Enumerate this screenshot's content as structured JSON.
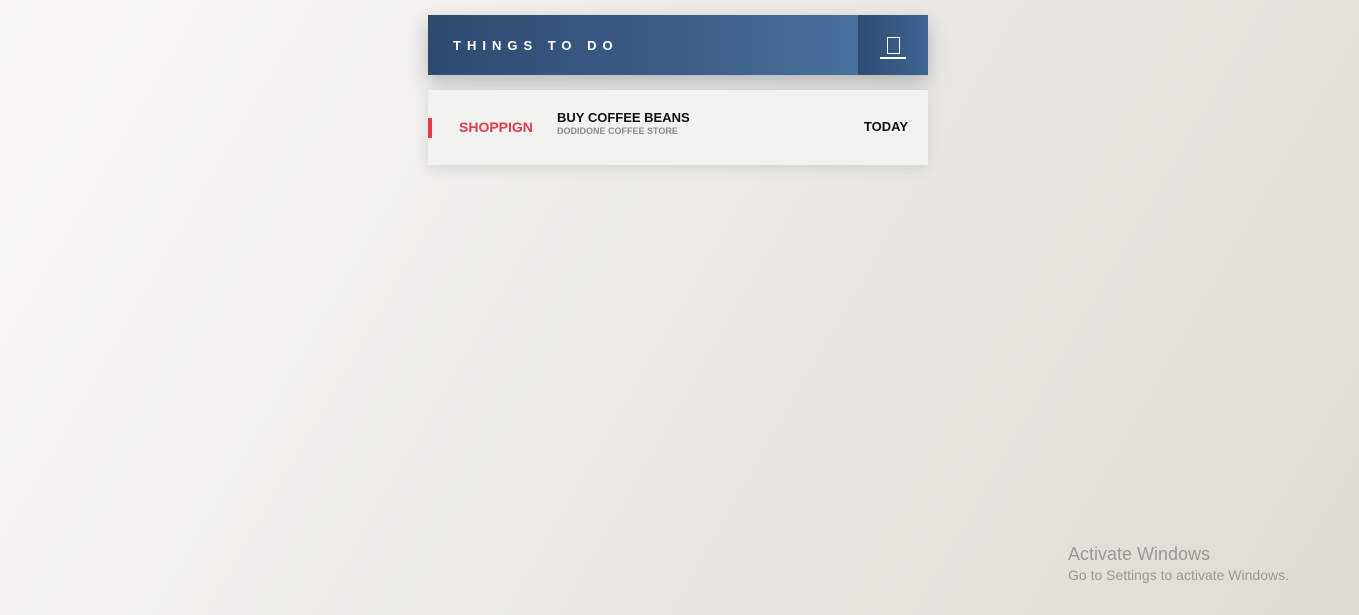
{
  "header": {
    "title": "THINGS TO DO",
    "action_icon": "notebook-icon"
  },
  "tasks": [
    {
      "category": "SHOPPIGN",
      "category_color": "#e03b4c",
      "title": "BUY COFFEE BEANS",
      "subtitle": "DODIDONE COFFEE STORE",
      "due": "TODAY"
    }
  ],
  "watermark": {
    "title": "Activate Windows",
    "subtitle": "Go to Settings to activate Windows."
  },
  "colors": {
    "header_gradient_start": "#2e4a6f",
    "header_gradient_end": "#4d79a6",
    "accent_red": "#e03b4c"
  }
}
